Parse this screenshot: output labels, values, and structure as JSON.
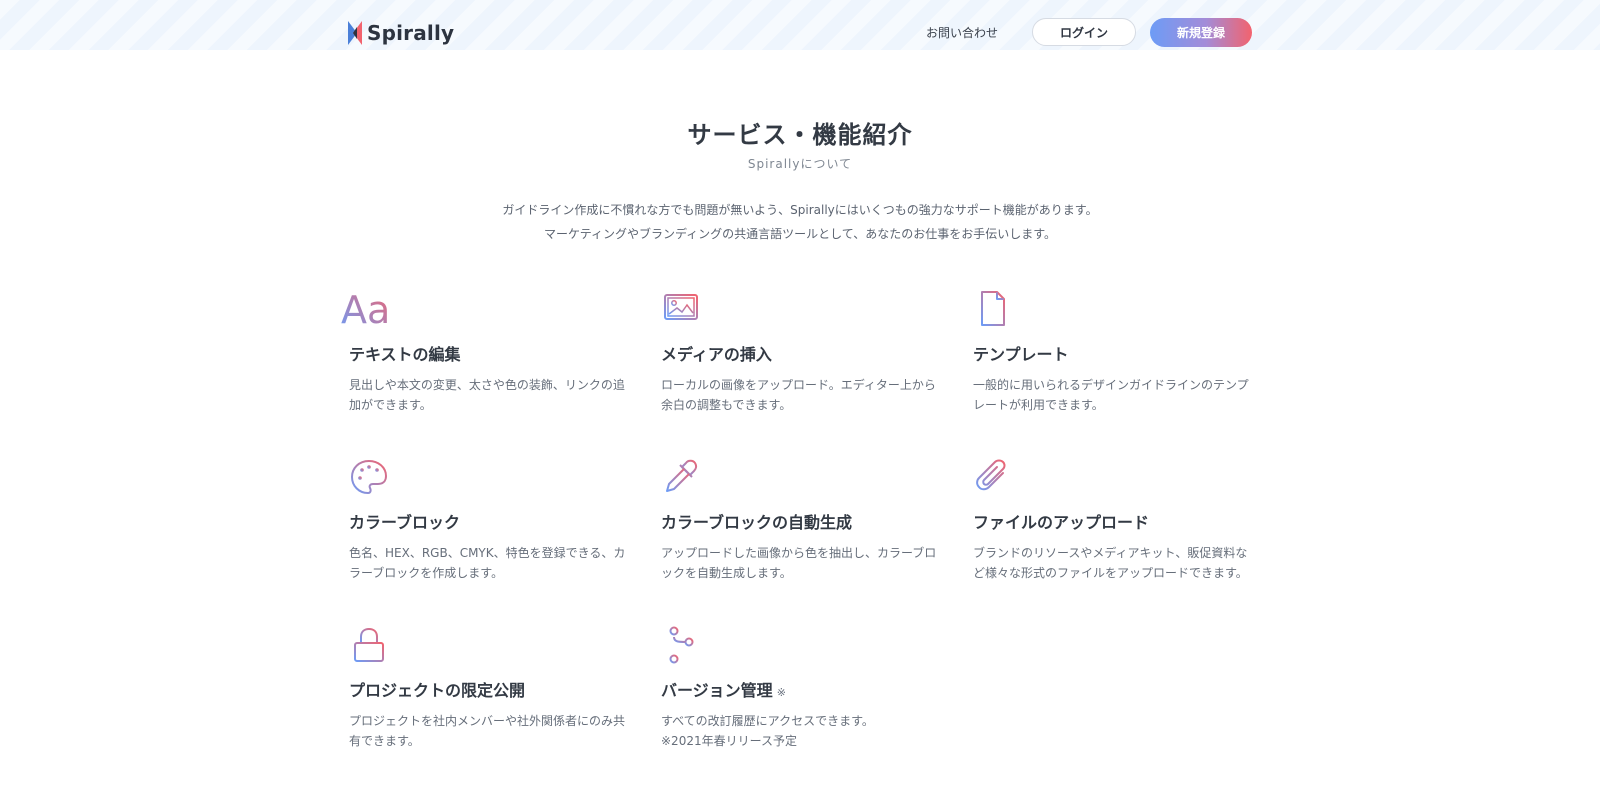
{
  "header": {
    "logo_text": "Spirally",
    "contact": "お問い合わせ",
    "login": "ログイン",
    "signup": "新規登録"
  },
  "section": {
    "title": "サービス・機能紹介",
    "subtitle": "Spirallyについて",
    "intro_lines": [
      "ガイドライン作成に不慣れな方でも問題が無いよう、Spirallyにはいくつもの強力なサポート機能があります。",
      "マーケティングやブランディングの共通言語ツールとして、あなたのお仕事をお手伝いします。"
    ]
  },
  "features": [
    {
      "icon": "typography-icon",
      "title": "テキストの編集",
      "desc": "見出しや本文の変更、太さや色の装飾、リンクの追加ができます。"
    },
    {
      "icon": "image-icon",
      "title": "メディアの挿入",
      "desc": "ローカルの画像をアップロード。エディター上から余白の調整もできます。"
    },
    {
      "icon": "document-icon",
      "title": "テンプレート",
      "desc": "一般的に用いられるデザインガイドラインのテンプレートが利用できます。"
    },
    {
      "icon": "palette-icon",
      "title": "カラーブロック",
      "desc": "色名、HEX、RGB、CMYK、特色を登録できる、カラーブロックを作成します。"
    },
    {
      "icon": "eyedropper-icon",
      "title": "カラーブロックの自動生成",
      "desc": "アップロードした画像から色を抽出し、カラーブロックを自動生成します。"
    },
    {
      "icon": "paperclip-icon",
      "title": "ファイルのアップロード",
      "desc": "ブランドのリソースやメディアキット、販促資料など様々な形式のファイルをアップロードできます。"
    },
    {
      "icon": "lock-icon",
      "title": "プロジェクトの限定公開",
      "desc": "プロジェクトを社内メンバーや社外関係者にのみ共有できます。"
    },
    {
      "icon": "branch-icon",
      "title": "バージョン管理",
      "title_note": "※",
      "desc": "すべての改訂履歴にアクセスできます。",
      "desc_note": "※2021年春リリース予定"
    }
  ],
  "colors": {
    "gradient_start": "#6d9cf6",
    "gradient_end": "#f2636e",
    "header_bg": "#eef5fd"
  }
}
